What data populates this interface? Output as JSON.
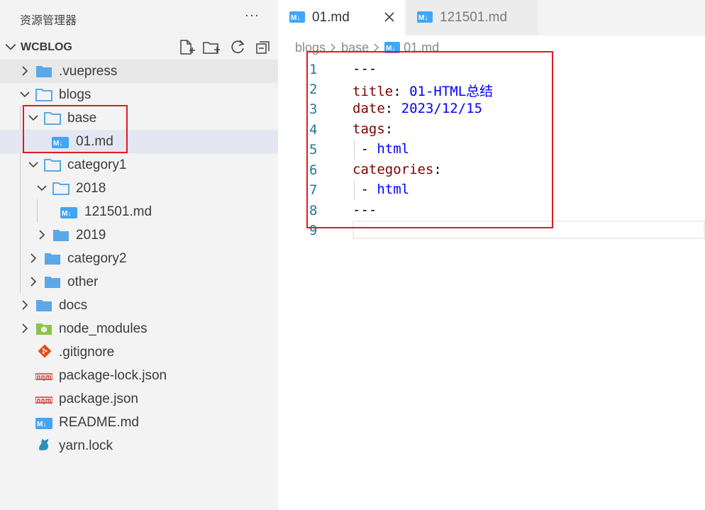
{
  "sidebar": {
    "title": "资源管理器",
    "more": "···",
    "workspace": "WCBLOG"
  },
  "tree": [
    {
      "label": ".vuepress"
    },
    {
      "label": "blogs"
    },
    {
      "label": "base"
    },
    {
      "label": "01.md"
    },
    {
      "label": "category1"
    },
    {
      "label": "2018"
    },
    {
      "label": "121501.md"
    },
    {
      "label": "2019"
    },
    {
      "label": "category2"
    },
    {
      "label": "other"
    },
    {
      "label": "docs"
    },
    {
      "label": "node_modules"
    },
    {
      "label": ".gitignore"
    },
    {
      "label": "package-lock.json"
    },
    {
      "label": "package.json"
    },
    {
      "label": "README.md"
    },
    {
      "label": "yarn.lock"
    }
  ],
  "tabs": [
    {
      "label": "01.md",
      "icon": "markdown-icon"
    },
    {
      "label": "121501.md",
      "icon": "markdown-icon"
    }
  ],
  "breadcrumb": {
    "part1": "blogs",
    "part2": "base",
    "part3": "01.md"
  },
  "editor": {
    "lines": [
      {
        "n": "1",
        "a": "---",
        "b": "",
        "c": ""
      },
      {
        "n": "2",
        "a": "title",
        "b": ": ",
        "c": "01-HTML总结"
      },
      {
        "n": "3",
        "a": "date",
        "b": ": ",
        "c": "2023/12/15"
      },
      {
        "n": "4",
        "a": "tags",
        "b": ":",
        "c": ""
      },
      {
        "n": "5",
        "a": "",
        "b": " - ",
        "c": "html"
      },
      {
        "n": "6",
        "a": "categories",
        "b": ":",
        "c": ""
      },
      {
        "n": "7",
        "a": "",
        "b": " - ",
        "c": "html"
      },
      {
        "n": "8",
        "a": "---",
        "b": "",
        "c": ""
      },
      {
        "n": "9",
        "a": "",
        "b": "",
        "c": ""
      }
    ]
  },
  "colors": {
    "highlight_box": "#e01b24",
    "folder": "#5aa8e8",
    "markdown": "#42a5f5",
    "yaml_key": "#800000",
    "yaml_value": "#0000ff",
    "line_number": "#237893"
  }
}
